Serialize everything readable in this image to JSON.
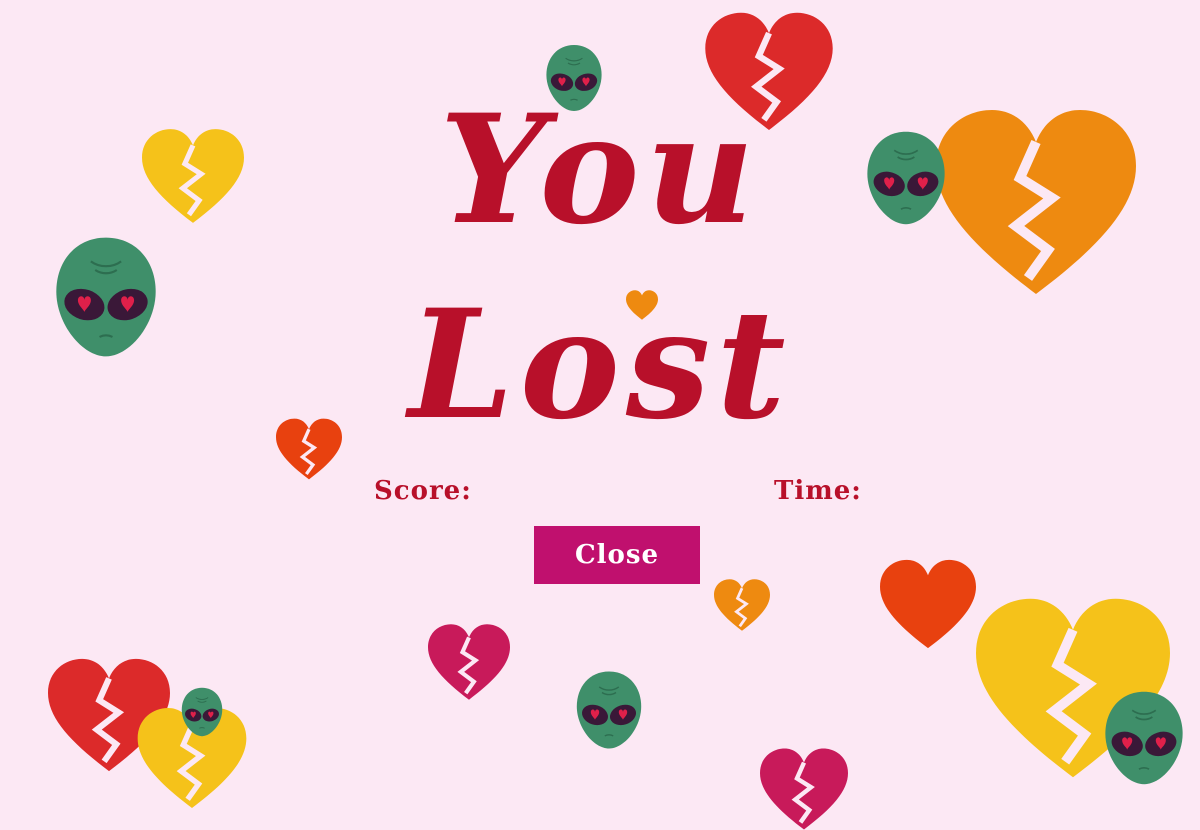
{
  "title": {
    "line1": "You",
    "line2": "Lost"
  },
  "stats": {
    "score_label": "Score:",
    "score_value": "",
    "time_label": "Time:",
    "time_value": ""
  },
  "close_button": {
    "label": "Close"
  },
  "colors": {
    "background": "#fce8f4",
    "title": "#b8102a",
    "button": "#c0106e",
    "alien_skin": "#3f8f6a",
    "alien_eyes": "#3a1838",
    "heart_red": "#dc2a2a",
    "heart_orange": "#ee8a10",
    "heart_yellow": "#f5c21a",
    "heart_magenta": "#c81a5a",
    "heart_deep_orange": "#e8410f"
  },
  "decorations": {
    "icons": [
      "broken-heart-icon",
      "heart-icon",
      "alien-head-icon"
    ]
  }
}
